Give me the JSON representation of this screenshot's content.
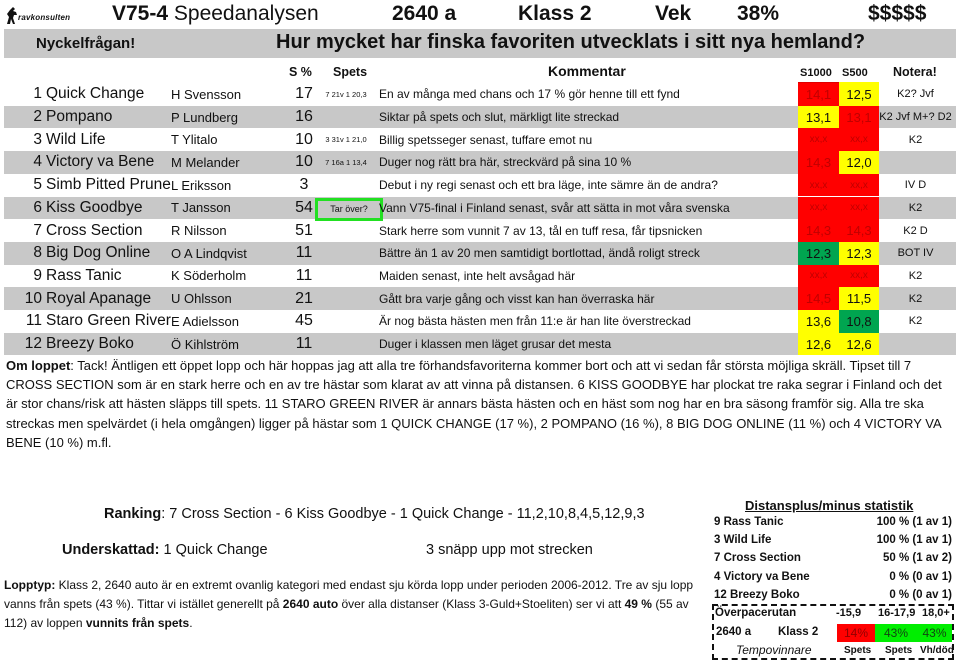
{
  "header": {
    "logo_text": "ravkonsulten",
    "race_code": "V75-4",
    "race_title": "Speedanalysen",
    "distance": "2640 a",
    "race_class": "Klass 2",
    "vek_label": "Vek",
    "vek_value": "38%",
    "dollars": "$$$$$"
  },
  "key_question": {
    "label": "Nyckelfrågan!",
    "question": "Hur mycket har finska favoriten utvecklats i sitt nya hemland?"
  },
  "columns": {
    "s_pct": "S %",
    "spets": "Spets",
    "kommentar": "Kommentar",
    "s1000": "S1000",
    "s500": "S500",
    "notera": "Notera!"
  },
  "colors": {
    "red": "#ff0000",
    "yellow": "#ffff00",
    "green": "#00a550",
    "highlight_border": "#22e022",
    "row_shade": "#c8c8c8"
  },
  "horses": [
    {
      "num": "1",
      "name": "Quick Change",
      "driver": "H Svensson",
      "pct": "17",
      "spets": "7 21v 1 20,3",
      "comment": "En av många med chans och 17 % gör henne till ett fynd",
      "s1000": "14,1",
      "s1000_color": "red",
      "s500": "12,5",
      "s500_color": "yellow",
      "note": "K2? Jvf"
    },
    {
      "num": "2",
      "name": "Pompano",
      "driver": "P Lundberg",
      "pct": "16",
      "spets": "",
      "comment": "Siktar på spets och slut, märkligt lite streckad",
      "s1000": "13,1",
      "s1000_color": "yellow",
      "s500": "13,1",
      "s500_color": "red",
      "note": "K2 Jvf M+? D2"
    },
    {
      "num": "3",
      "name": "Wild Life",
      "driver": "T Ylitalo",
      "pct": "10",
      "spets": "3 31v 1 21,0",
      "comment": "Billig spetsseger senast, tuffare emot nu",
      "s1000": "xx,x",
      "s1000_color": "red",
      "s500": "xx,x",
      "s500_color": "red",
      "note": "K2"
    },
    {
      "num": "4",
      "name": "Victory va Bene",
      "driver": "M Melander",
      "pct": "10",
      "spets": "7 16a 1 13,4",
      "comment": "Duger nog rätt bra här, streckvärd på sina 10 %",
      "s1000": "14,3",
      "s1000_color": "red",
      "s500": "12,0",
      "s500_color": "yellow",
      "note": ""
    },
    {
      "num": "5",
      "name": "Simb Pitted Prune",
      "driver": "L Eriksson",
      "pct": "3",
      "spets": "",
      "comment": "Debut i ny regi senast och ett bra läge, inte sämre än de andra?",
      "s1000": "xx,x",
      "s1000_color": "red",
      "s500": "xx,x",
      "s500_color": "red",
      "note": "IV D"
    },
    {
      "num": "6",
      "name": "Kiss Goodbye",
      "driver": "T Jansson",
      "pct": "54",
      "spets": "Tar över?",
      "comment": "Vann V75-final i Finland senast, svår att sätta in mot våra svenska",
      "s1000": "xx,x",
      "s1000_color": "red",
      "s500": "xx,x",
      "s500_color": "red",
      "note": "K2"
    },
    {
      "num": "7",
      "name": "Cross Section",
      "driver": "R Nilsson",
      "pct": "51",
      "spets": "",
      "comment": "Stark herre som vunnit 7 av 13, tål en tuff resa, får tipsnicken",
      "s1000": "14,3",
      "s1000_color": "red",
      "s500": "14,3",
      "s500_color": "red",
      "note": "K2 D"
    },
    {
      "num": "8",
      "name": "Big Dog Online",
      "driver": "O A Lindqvist",
      "pct": "11",
      "spets": "",
      "comment": "Bättre än 1 av 20 men samtidigt bortlottad, ändå roligt streck",
      "s1000": "12,3",
      "s1000_color": "green",
      "s500": "12,3",
      "s500_color": "yellow",
      "note": "BOT IV"
    },
    {
      "num": "9",
      "name": "Rass Tanic",
      "driver": "K Söderholm",
      "pct": "11",
      "spets": "",
      "comment": "Maiden senast, inte helt avsågad här",
      "s1000": "xx,x",
      "s1000_color": "red",
      "s500": "xx,x",
      "s500_color": "red",
      "note": "K2"
    },
    {
      "num": "10",
      "name": "Royal Apanage",
      "driver": "U Ohlsson",
      "pct": "21",
      "spets": "",
      "comment": "Gått bra varje gång och visst kan han överraska här",
      "s1000": "14,5",
      "s1000_color": "red",
      "s500": "11,5",
      "s500_color": "yellow",
      "note": "K2"
    },
    {
      "num": "11",
      "name": "Staro Green River",
      "driver": "E Adielsson",
      "pct": "45",
      "spets": "",
      "comment": "Är nog bästa hästen men från 11:e är han lite överstreckad",
      "s1000": "13,6",
      "s1000_color": "yellow",
      "s500": "10,8",
      "s500_color": "green",
      "note": "K2"
    },
    {
      "num": "12",
      "name": "Breezy Boko",
      "driver": "Ö Kihlström",
      "pct": "11",
      "spets": "",
      "comment": "Duger i klassen men läget grusar det mesta",
      "s1000": "12,6",
      "s1000_color": "yellow",
      "s500": "12,6",
      "s500_color": "yellow",
      "note": ""
    }
  ],
  "om_loppet": {
    "label": "Om loppet",
    "text": ": Tack! Äntligen ett öppet lopp och här hoppas jag att alla tre förhandsfavoriterna kommer bort och att vi sedan får största möjliga skräll. Tipset till 7 CROSS SECTION som är en stark herre och en av tre hästar som klarat av att vinna på distansen. 6 KISS GOODBYE har plockat tre raka segrar i Finland och det är stor chans/risk att hästen släpps till spets. 11 STARO GREEN RIVER är annars bästa hästen och en häst som nog har en bra säsong framför sig. Alla tre ska streckas men spelvärdet (i hela omgången) ligger på hästar som 1 QUICK CHANGE (17 %), 2 POMPANO (16 %), 8 BIG DOG ONLINE (11 %) och 4 VICTORY VA BENE (10 %) m.fl."
  },
  "ranking": {
    "label": "Ranking",
    "value": ": 7 Cross Section - 6 Kiss Goodbye - 1 Quick Change - 11,2,10,8,4,5,12,9,3"
  },
  "underskattad": {
    "label": "Underskattad:",
    "value": " 1 Quick Change",
    "note": "3 snäpp upp mot strecken"
  },
  "lopptyp": {
    "label": "Lopptyp:",
    "part1": " Klass 2, 2640 auto är en extremt ovanlig kategori med endast sju körda lopp under perioden 2006-2012. Tre av sju lopp vanns från spets (43 %). Tittar vi istället generellt på ",
    "bold1": "2640 auto",
    "part2": " över alla distanser (Klass 3-Guld+Stoeliten) ser vi att ",
    "bold2": "49 %",
    "part3": " (55 av 112) av loppen ",
    "bold3": "vunnits från spets",
    "part4": "."
  },
  "distans_stats": {
    "title": "Distansplus/minus statistik",
    "rows": [
      {
        "name": "9 Rass Tanic",
        "value": "100 % (1 av 1)"
      },
      {
        "name": "3 Wild Life",
        "value": "100 % (1 av 1)"
      },
      {
        "name": "7 Cross Section",
        "value": "50 % (1 av 2)"
      },
      {
        "name": "4 Victory va Bene",
        "value": "0 % (0 av 1)"
      },
      {
        "name": "12 Breezy Boko",
        "value": "0 % (0 av 1)"
      }
    ]
  },
  "overpace": {
    "title": "Överpacerutan",
    "ranges": [
      "-15,9",
      "16-17,9",
      "18,0+"
    ],
    "distance": "2640 a",
    "race_class": "Klass 2",
    "values": [
      "14%",
      "43%",
      "43%"
    ],
    "value_colors": [
      "#ff0000",
      "#00ee00",
      "#00ee00"
    ],
    "footer_label": "Tempovinnare",
    "footer_cols": [
      "Spets",
      "Spets",
      "Vh/död"
    ]
  }
}
